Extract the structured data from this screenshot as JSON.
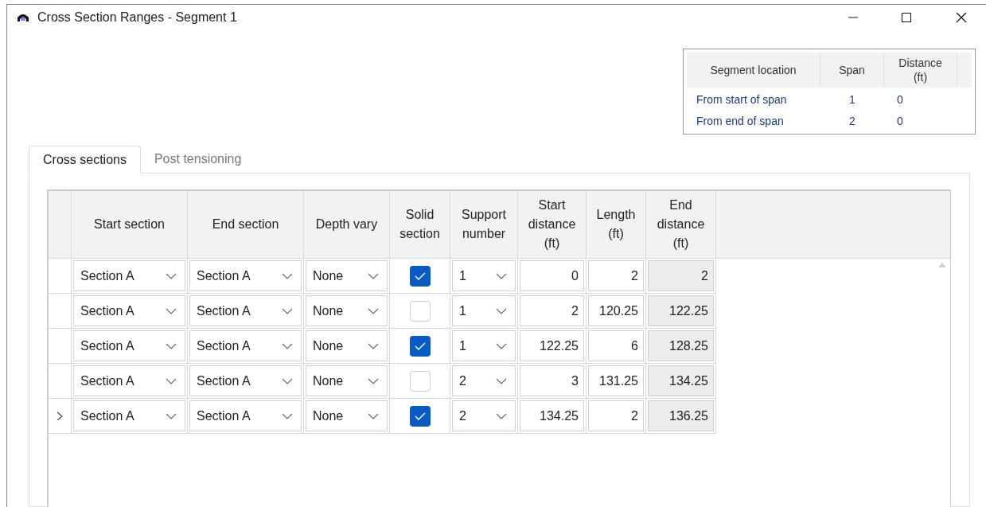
{
  "window": {
    "title": "Cross Section Ranges - Segment 1"
  },
  "segment_table": {
    "columns": [
      "Segment location",
      "Span",
      "Distance (ft)"
    ],
    "rows": [
      {
        "location": "From start of span",
        "span": "1",
        "distance": "0"
      },
      {
        "location": "From end of span",
        "span": "2",
        "distance": "0"
      }
    ]
  },
  "tabs": [
    {
      "label": "Cross sections",
      "selected": true
    },
    {
      "label": "Post tensioning",
      "selected": false
    }
  ],
  "grid": {
    "columns": [
      "Start section",
      "End section",
      "Depth vary",
      "Solid section",
      "Support number",
      "Start distance (ft)",
      "Length (ft)",
      "End distance (ft)"
    ],
    "rows": [
      {
        "current": false,
        "start_section": "Section A",
        "end_section": "Section A",
        "depth_vary": "None",
        "solid": true,
        "support": "1",
        "start_distance": "0",
        "length": "2",
        "end_distance": "2"
      },
      {
        "current": false,
        "start_section": "Section A",
        "end_section": "Section A",
        "depth_vary": "None",
        "solid": false,
        "support": "1",
        "start_distance": "2",
        "length": "120.25",
        "end_distance": "122.25"
      },
      {
        "current": false,
        "start_section": "Section A",
        "end_section": "Section A",
        "depth_vary": "None",
        "solid": true,
        "support": "1",
        "start_distance": "122.25",
        "length": "6",
        "end_distance": "128.25"
      },
      {
        "current": false,
        "start_section": "Section A",
        "end_section": "Section A",
        "depth_vary": "None",
        "solid": false,
        "support": "2",
        "start_distance": "3",
        "length": "131.25",
        "end_distance": "134.25"
      },
      {
        "current": true,
        "start_section": "Section A",
        "end_section": "Section A",
        "depth_vary": "None",
        "solid": true,
        "support": "2",
        "start_distance": "134.25",
        "length": "2",
        "end_distance": "136.25"
      }
    ]
  }
}
